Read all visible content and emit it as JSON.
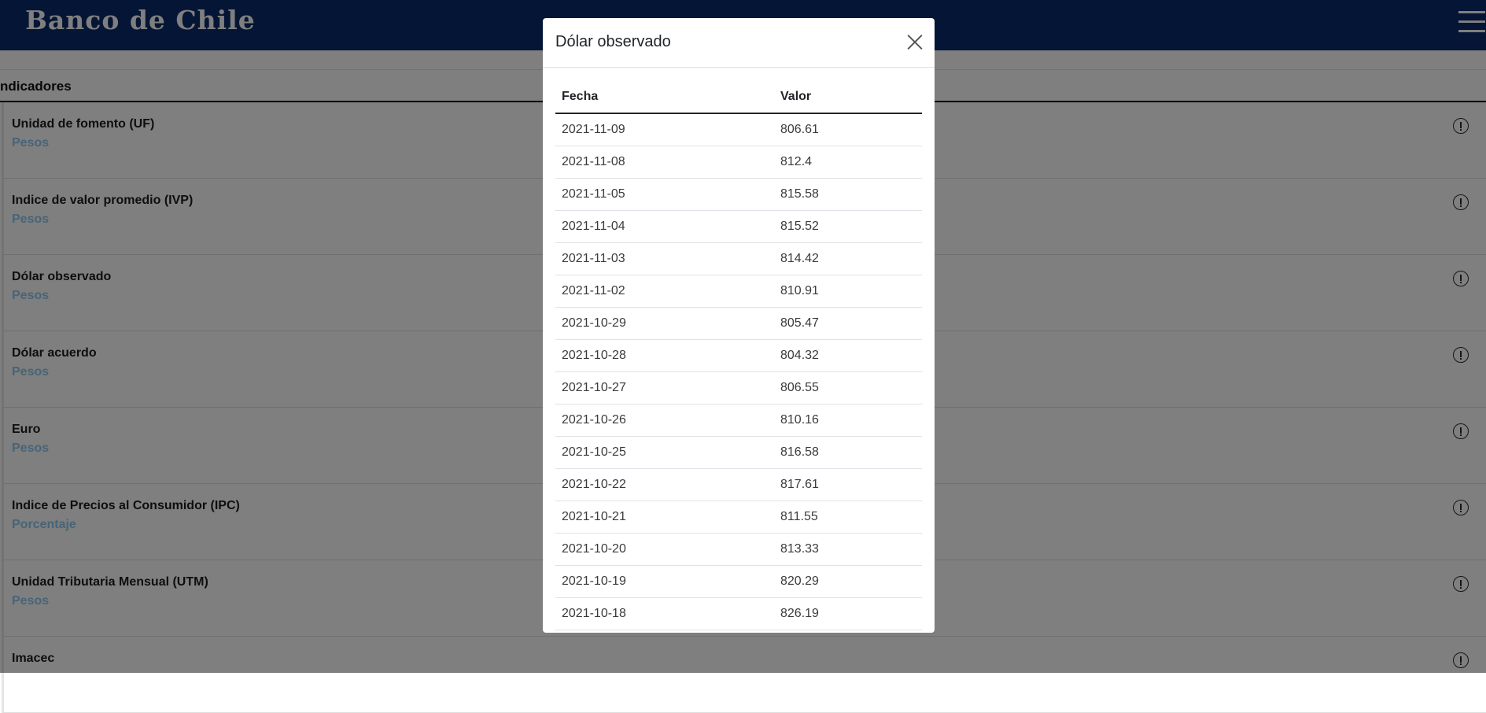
{
  "header": {
    "logo": "Banco de Chile"
  },
  "section": {
    "title": "ndicadores"
  },
  "indicators": [
    {
      "title": "Unidad de fomento (UF)",
      "unit": "Pesos"
    },
    {
      "title": "Indice de valor promedio (IVP)",
      "unit": "Pesos"
    },
    {
      "title": "Dólar observado",
      "unit": "Pesos"
    },
    {
      "title": "Dólar acuerdo",
      "unit": "Pesos"
    },
    {
      "title": "Euro",
      "unit": "Pesos"
    },
    {
      "title": "Indice de Precios al Consumidor (IPC)",
      "unit": "Porcentaje"
    },
    {
      "title": "Unidad Tributaria Mensual (UTM)",
      "unit": "Pesos"
    },
    {
      "title": "Imacec",
      "unit": ""
    }
  ],
  "modal": {
    "title": "Dólar observado",
    "columns": {
      "fecha": "Fecha",
      "valor": "Valor"
    },
    "rows": [
      {
        "fecha": "2021-11-09",
        "valor": "806.61"
      },
      {
        "fecha": "2021-11-08",
        "valor": "812.4"
      },
      {
        "fecha": "2021-11-05",
        "valor": "815.58"
      },
      {
        "fecha": "2021-11-04",
        "valor": "815.52"
      },
      {
        "fecha": "2021-11-03",
        "valor": "814.42"
      },
      {
        "fecha": "2021-11-02",
        "valor": "810.91"
      },
      {
        "fecha": "2021-10-29",
        "valor": "805.47"
      },
      {
        "fecha": "2021-10-28",
        "valor": "804.32"
      },
      {
        "fecha": "2021-10-27",
        "valor": "806.55"
      },
      {
        "fecha": "2021-10-26",
        "valor": "810.16"
      },
      {
        "fecha": "2021-10-25",
        "valor": "816.58"
      },
      {
        "fecha": "2021-10-22",
        "valor": "817.61"
      },
      {
        "fecha": "2021-10-21",
        "valor": "811.55"
      },
      {
        "fecha": "2021-10-20",
        "valor": "813.33"
      },
      {
        "fecha": "2021-10-19",
        "valor": "820.29"
      },
      {
        "fecha": "2021-10-18",
        "valor": "826.19"
      }
    ]
  }
}
